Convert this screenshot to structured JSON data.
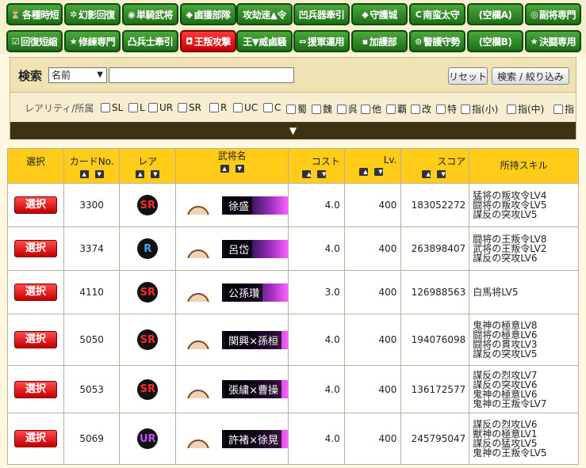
{
  "tabs_row1": [
    {
      "icon": "⏳",
      "label": "各種時短"
    },
    {
      "icon": "✲",
      "label": "幻影回復"
    },
    {
      "icon": "◉",
      "label": "単騎武将"
    },
    {
      "icon": "◆",
      "label": "鹵獲部隊"
    },
    {
      "icon": "",
      "label": "攻劫速▲令"
    },
    {
      "icon": "",
      "label": "凹兵器牽引"
    },
    {
      "icon": "◆",
      "label": "守護城"
    },
    {
      "icon": "C",
      "label": "南蛮太守"
    },
    {
      "icon": "",
      "label": "(空欄A)"
    },
    {
      "icon": "◎",
      "label": "副将専門"
    }
  ],
  "tabs_row2": [
    {
      "icon": "☑",
      "label": "回復短縮"
    },
    {
      "icon": "★",
      "label": "修練専門"
    },
    {
      "icon": "",
      "label": "凸兵士牽引"
    },
    {
      "icon": "◘",
      "label": "王叛攻撃"
    },
    {
      "icon": "",
      "label": "王▼威鹵騒"
    },
    {
      "icon": "⇔",
      "label": "援軍運用"
    },
    {
      "icon": "▪",
      "label": "加護部"
    },
    {
      "icon": "⊙",
      "label": "警護守勢"
    },
    {
      "icon": "",
      "label": "(空欄B)"
    },
    {
      "icon": "★",
      "label": "決闘専用"
    }
  ],
  "search": {
    "title": "検索",
    "field_select": "名前",
    "text_value": "",
    "reset_label": "リセット",
    "filter_label": "検索 / 絞り込み",
    "rarity_label": "レアリティ/所属",
    "checkboxes": [
      "SL",
      "L",
      "UR",
      "SR",
      "R",
      "UC",
      "C",
      "蜀",
      "魏",
      "呉",
      "他",
      "覇",
      "改",
      "特",
      "指(小)",
      "指(中)",
      "指"
    ],
    "expand_glyph": "▼"
  },
  "table": {
    "headers": [
      "選択",
      "カードNo.",
      "レア",
      "武将名",
      "コスト",
      "Lv.",
      "スコア",
      "所持スキル"
    ],
    "select_label": "選択",
    "rows": [
      {
        "no": "3300",
        "rare": "SR",
        "rare_color": "#ff2a2a",
        "name": "徐盛",
        "cost": "4.0",
        "lv": "400",
        "score": "183052272",
        "skills": [
          "猛将の叛攻令LV4",
          "闘将の叛攻令LV5",
          "謀反の突攻LV5"
        ]
      },
      {
        "no": "3374",
        "rare": "R",
        "rare_color": "#39a8ff",
        "name": "呂岱",
        "cost": "4.0",
        "lv": "400",
        "score": "263898407",
        "skills": [
          "闘将の王叛令LV8",
          "武将の王叛令LV2",
          "謀反の突攻LV6"
        ]
      },
      {
        "no": "4110",
        "rare": "SR",
        "rare_color": "#ff2a2a",
        "name": "公孫瓚",
        "cost": "3.0",
        "lv": "400",
        "score": "126988563",
        "skills": [
          "白馬将LV5"
        ]
      },
      {
        "no": "5050",
        "rare": "SR",
        "rare_color": "#ff2a2a",
        "name": "関興×孫桓",
        "cost": "4.0",
        "lv": "400",
        "score": "194076098",
        "skills": [
          "鬼神の極意LV8",
          "闘将の極意LV6",
          "闘将の貫攻LV3",
          "謀反の突攻LV5"
        ]
      },
      {
        "no": "5053",
        "rare": "SR",
        "rare_color": "#ff2a2a",
        "name": "張繍×曹操",
        "cost": "4.0",
        "lv": "400",
        "score": "136172577",
        "skills": [
          "謀反の烈攻LV7",
          "謀反の突攻LV6",
          "鬼神の極意LV6",
          "鬼神の王叛令LV7"
        ]
      },
      {
        "no": "5069",
        "rare": "UR",
        "rare_color": "#c04cff",
        "name": "許褚×徐晃",
        "cost": "4.0",
        "lv": "400",
        "score": "245795047",
        "skills": [
          "謀反の烈攻LV6",
          "獣神の極意LV1",
          "謀反の猛攻LV5",
          "鬼神の王叛令LV5"
        ]
      }
    ]
  }
}
